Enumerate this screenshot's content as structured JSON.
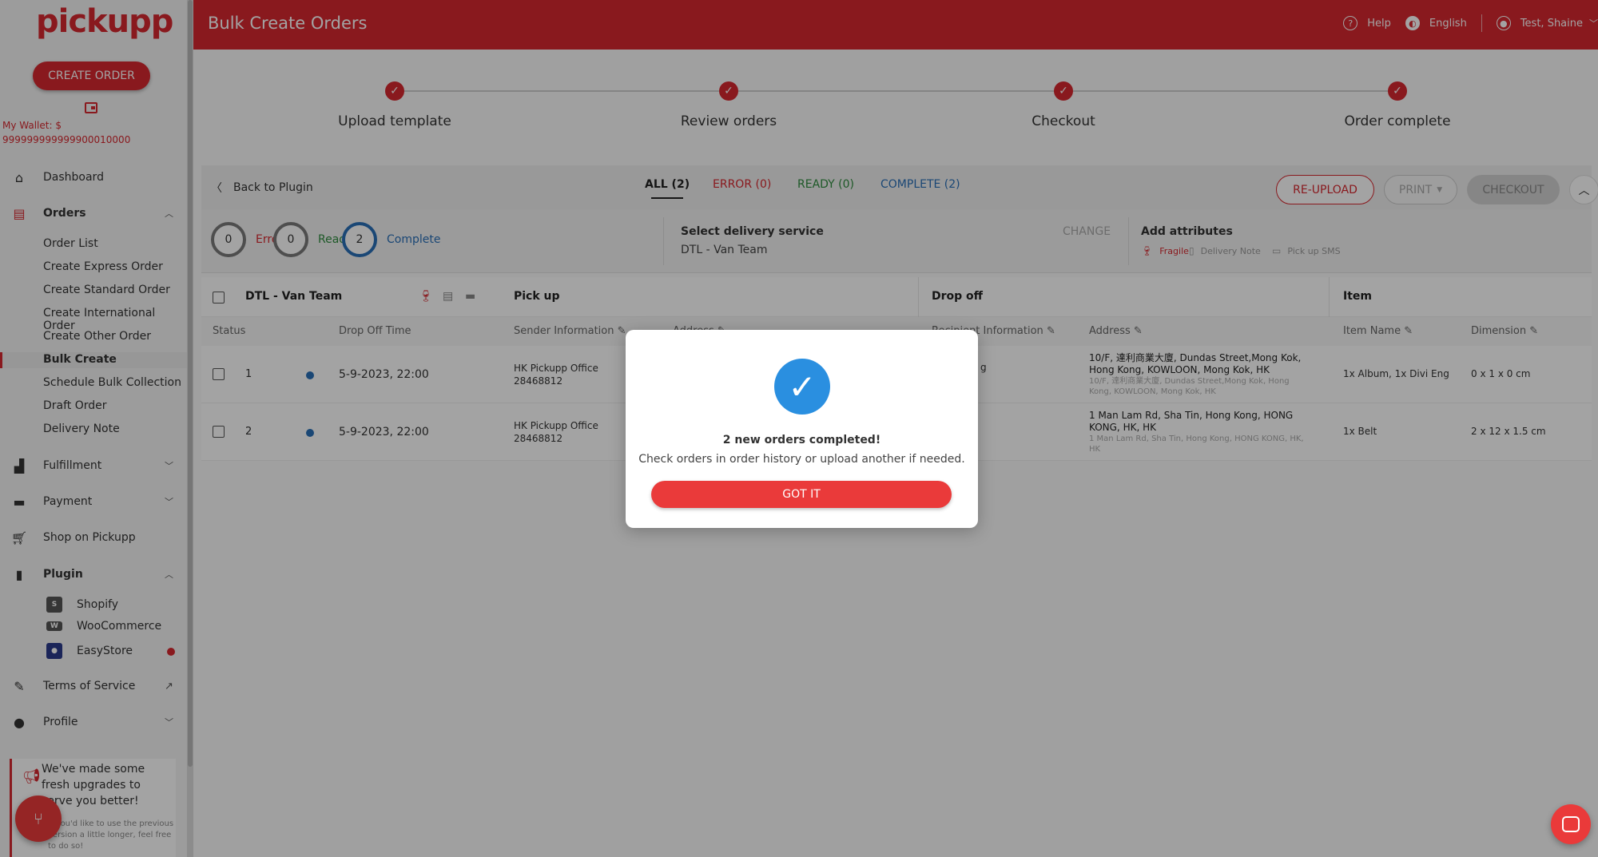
{
  "app": {
    "logo_text": "pickupp",
    "brand_color": "#d7282f",
    "accent_blue": "#2a6fb8"
  },
  "sidebar": {
    "create_order": "CREATE ORDER",
    "wallet_label": "My Wallet: $",
    "wallet_value": "999999999999900010000",
    "dashboard": "Dashboard",
    "orders": "Orders",
    "orders_sub": [
      "Order List",
      "Create Express Order",
      "Create Standard Order",
      "Create International Order",
      "Create Other Order",
      "Bulk Create",
      "Schedule Bulk Collection",
      "Draft Order",
      "Delivery Note"
    ],
    "fulfillment": "Fulfillment",
    "payment": "Payment",
    "shop": "Shop on Pickupp",
    "plugin": "Plugin",
    "plugins": [
      "Shopify",
      "WooCommerce",
      "EasyStore"
    ],
    "terms": "Terms of Service",
    "profile": "Profile",
    "promo_title": "We've made some fresh upgrades to serve you better!",
    "promo_text": "If you'd like to use the previous version a little longer, feel free to do so!"
  },
  "header": {
    "title": "Bulk Create Orders",
    "help": "Help",
    "language": "English",
    "user": "Test, Shaine"
  },
  "steps": [
    "Upload template",
    "Review orders",
    "Checkout",
    "Order complete"
  ],
  "toolbar": {
    "back": "Back to Plugin",
    "tab_all": "ALL (2)",
    "tab_error": "ERROR (0)",
    "tab_ready": "READY (0)",
    "tab_complete": "COMPLETE (2)",
    "reupload": "RE-UPLOAD",
    "print": "PRINT",
    "checkout": "CHECKOUT"
  },
  "summary": {
    "error_count": "0",
    "error_label": "Error",
    "ready_count": "0",
    "ready_label": "Ready",
    "complete_count": "2",
    "complete_label": "Complete",
    "select_title": "Select delivery service",
    "select_value": "DTL - Van Team",
    "change": "CHANGE",
    "attr_title": "Add attributes",
    "attr_fragile": "Fragile",
    "attr_note": "Delivery Note",
    "attr_sms": "Pick up SMS"
  },
  "table": {
    "group_service": "DTL - Van Team",
    "group_pickup": "Pick up",
    "group_dropoff": "Drop off",
    "group_item": "Item",
    "col_status": "Status",
    "col_time": "Drop Off Time",
    "col_sender": "Sender Information",
    "col_address_pickup": "Address",
    "col_recipient": "Recipient Information",
    "col_address": "Address",
    "col_item_name": "Item Name",
    "col_dimension": "Dimension",
    "rows": [
      {
        "num": "1",
        "time": "5-9-2023, 22:00",
        "sender_name": "HK Pickupp Office",
        "sender_phone": "28468812",
        "recipient_tail": "g",
        "address": "10/F, 達利商業大廈, Dundas Street,Mong Kok, Hong Kong, KOWLOON, Mong Kok, HK",
        "address_sub": "10/F, 達利商業大廈, Dundas Street,Mong Kok, Hong Kong, KOWLOON, Mong Kok, HK",
        "item": "1x Album, 1x Divi Eng",
        "dimension": "0 x 1 x 0 cm"
      },
      {
        "num": "2",
        "time": "5-9-2023, 22:00",
        "sender_name": "HK Pickupp Office",
        "sender_phone": "28468812",
        "address": "1 Man Lam Rd, Sha Tin, Hong Kong, HONG KONG, HK, HK",
        "address_sub": "1 Man Lam Rd, Sha Tin, Hong Kong, HONG KONG, HK, HK",
        "item": "1x Belt",
        "dimension": "2 x 12 x 1.5 cm"
      }
    ]
  },
  "modal": {
    "title": "2 new orders completed!",
    "text": "Check orders in order history or upload another if needed.",
    "button": "GOT IT"
  }
}
